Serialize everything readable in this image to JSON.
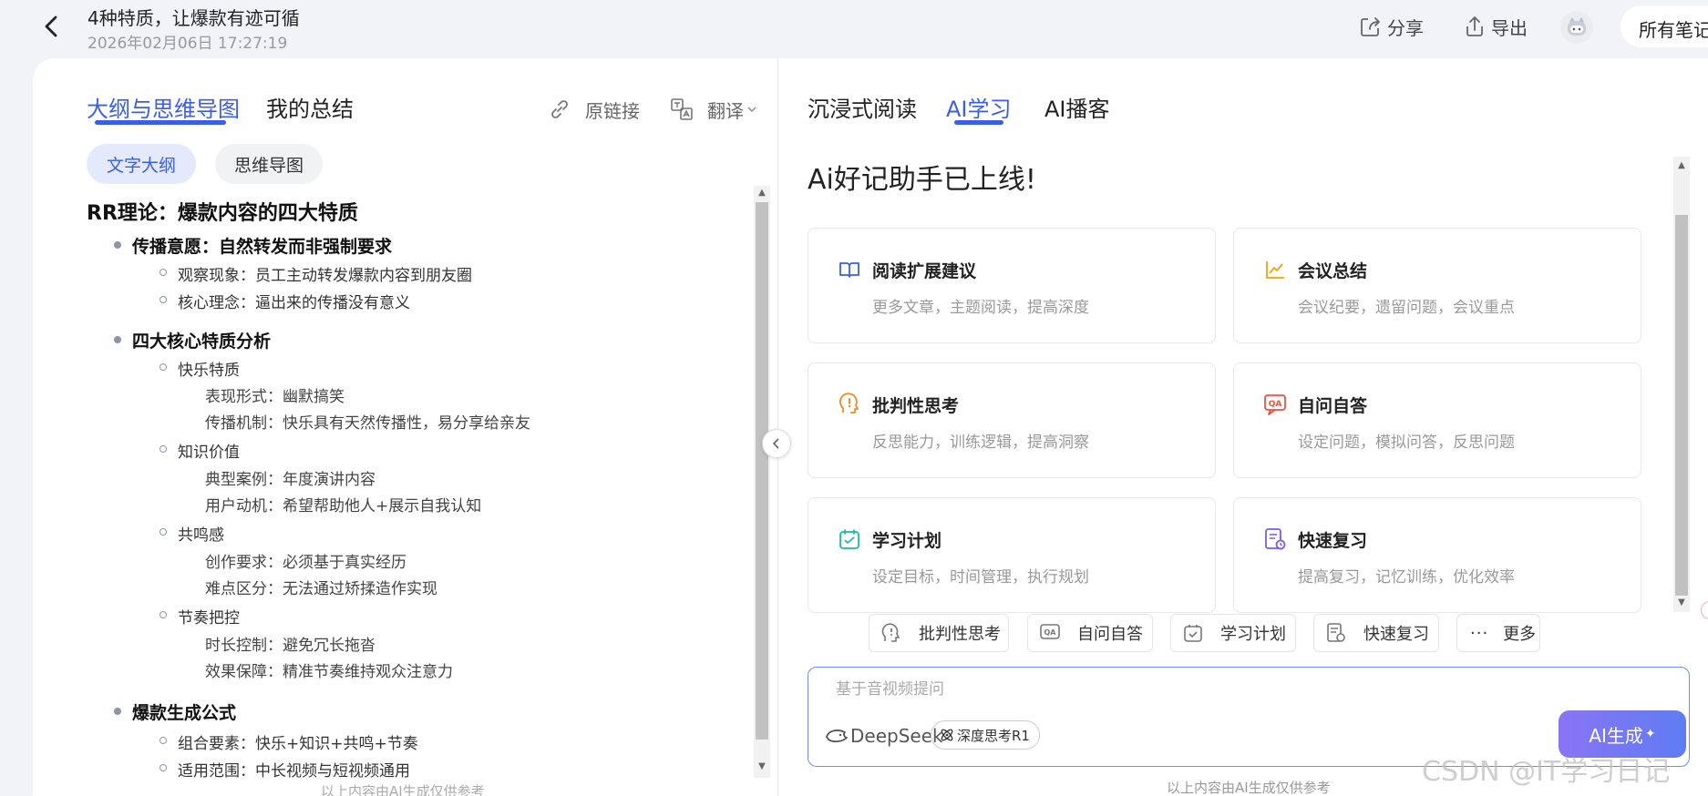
{
  "header": {
    "title": "4种特质，让爆款有迹可循",
    "timestamp": "2026年02月06日 17:27:19",
    "share_label": "分享",
    "export_label": "导出",
    "all_notes_label": "所有笔记"
  },
  "left": {
    "tabs": [
      "大纲与思维导图",
      "我的总结"
    ],
    "original_link_label": "原链接",
    "translate_label": "翻译",
    "view_chips": [
      "文字大纲",
      "思维导图"
    ],
    "outline": {
      "title": "RR理论：爆款内容的四大特质",
      "s1": {
        "heading": "传播意愿：自然转发而非强制要求",
        "items": [
          "观察现象：员工主动转发爆款内容到朋友圈",
          "核心理念：逼出来的传播没有意义"
        ]
      },
      "s2": {
        "heading": "四大核心特质分析",
        "g1": {
          "label": "快乐特质",
          "items": [
            "表现形式：幽默搞笑",
            "传播机制：快乐具有天然传播性，易分享给亲友"
          ]
        },
        "g2": {
          "label": "知识价值",
          "items": [
            "典型案例：年度演讲内容",
            "用户动机：希望帮助他人+展示自我认知"
          ]
        },
        "g3": {
          "label": "共鸣感",
          "items": [
            "创作要求：必须基于真实经历",
            "难点区分：无法通过矫揉造作实现"
          ]
        },
        "g4": {
          "label": "节奏把控",
          "items": [
            "时长控制：避免冗长拖沓",
            "效果保障：精准节奏维持观众注意力"
          ]
        }
      },
      "s3": {
        "heading": "爆款生成公式",
        "items": [
          "组合要素：快乐+知识+共鸣+节奏",
          "适用范围：中长视频与短视频通用"
        ]
      }
    },
    "disclaimer": "以上内容由AI生成仅供参考"
  },
  "right": {
    "tabs": [
      "沉浸式阅读",
      "AI学习",
      "AI播客"
    ],
    "welcome": "Ai好记助手已上线!",
    "features": [
      {
        "title": "阅读扩展建议",
        "desc": "更多文章，主题阅读，提高深度",
        "icon": "book-icon",
        "color": "#3a5ee8"
      },
      {
        "title": "会议总结",
        "desc": "会议纪要，遗留问题，会议重点",
        "icon": "chart-line-icon",
        "color": "#f0a500"
      },
      {
        "title": "批判性思考",
        "desc": "反思能力，训练逻辑，提高洞察",
        "icon": "head-alert-icon",
        "color": "#f08a24"
      },
      {
        "title": "自问自答",
        "desc": "设定问题，模拟问答，反思问题",
        "icon": "qa-icon",
        "color": "#f0503a"
      },
      {
        "title": "学习计划",
        "desc": "设定目标，时间管理，执行规划",
        "icon": "calendar-icon",
        "color": "#1fb8a6"
      },
      {
        "title": "快速复习",
        "desc": "提高复习，记忆训练，优化效率",
        "icon": "review-icon",
        "color": "#7a5ce8"
      }
    ],
    "quick_chips": [
      "批判性思考",
      "自问自答",
      "学习计划",
      "快速复习"
    ],
    "more_label": "更多",
    "input_placeholder": "基于音视频提问",
    "model_name": "DeepSeek",
    "deep_think_label": "深度思考R1",
    "generate_label": "AI生成",
    "disclaimer": "以上内容由AI生成仅供参考",
    "watermark": "CSDN @IT学习日记"
  }
}
